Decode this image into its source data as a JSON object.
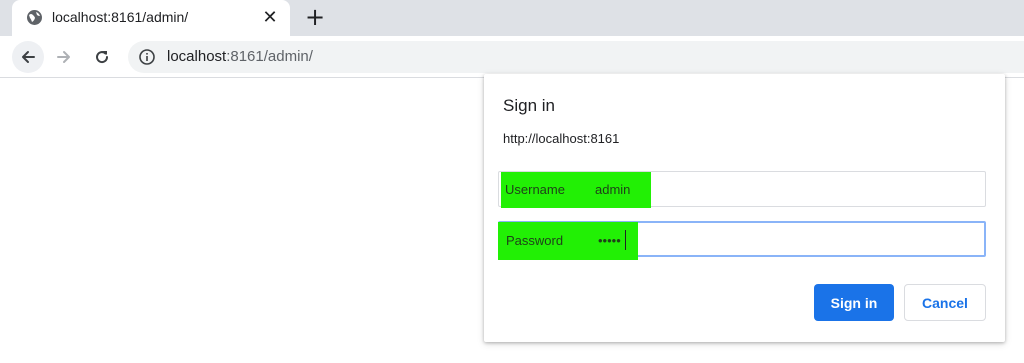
{
  "browser": {
    "tab": {
      "title": "localhost:8161/admin/",
      "favicon": "globe-icon",
      "close_glyph": "✕"
    },
    "new_tab_glyph": "+",
    "address": {
      "host": "localhost",
      "path": ":8161/admin/",
      "info_icon": "info-icon"
    }
  },
  "dialog": {
    "title": "Sign in",
    "origin": "http://localhost:8161",
    "username": {
      "label": "Username",
      "value": "admin"
    },
    "password": {
      "label": "Password",
      "value": "•••••"
    },
    "sign_in_label": "Sign in",
    "cancel_label": "Cancel"
  },
  "colors": {
    "accent": "#1a73e8",
    "highlight": "#22f005",
    "tabstrip": "#dee1e6"
  }
}
